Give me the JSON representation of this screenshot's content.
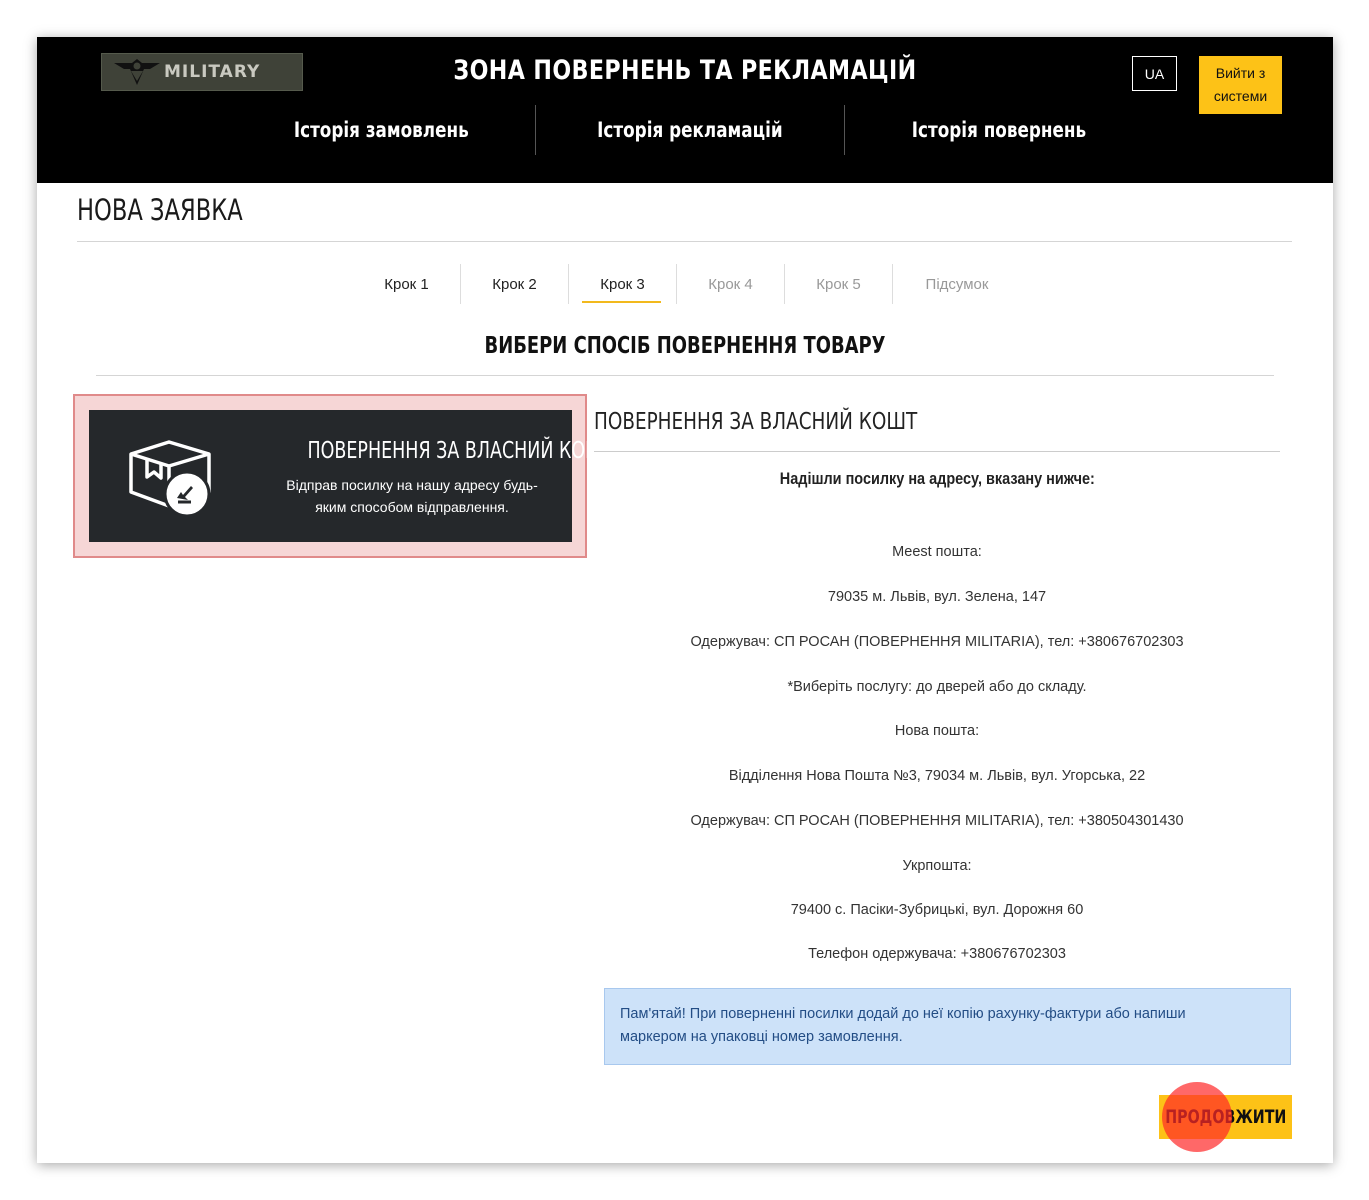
{
  "header": {
    "logo_text": "MILITARY",
    "title": "ЗОНА ПОВЕРНЕНЬ ТА РЕКЛАМАЦІЙ",
    "lang": "UA",
    "logout_line1": "Вийти з",
    "logout_line2": "системи",
    "nav": [
      {
        "label": "Історія замовлень"
      },
      {
        "label": "Історія рекламацій"
      },
      {
        "label": "Історія повернень"
      }
    ]
  },
  "page": {
    "title": "НОВА ЗАЯВКА",
    "steps": [
      {
        "label": "Крок 1",
        "state": "done"
      },
      {
        "label": "Крок 2",
        "state": "done"
      },
      {
        "label": "Крок 3",
        "state": "active"
      },
      {
        "label": "Крок 4",
        "state": "disabled"
      },
      {
        "label": "Крок 5",
        "state": "disabled"
      },
      {
        "label": "Підсумок",
        "state": "disabled"
      }
    ],
    "section_heading": "ВИБЕРИ СПОСІБ ПОВЕРНЕННЯ ТОВАРУ"
  },
  "option": {
    "icon": "box-return-icon",
    "title": "ПОВЕРНЕННЯ ЗА ВЛАСНИЙ КОШТ",
    "desc_line1": "Відправ посилку на нашу адресу будь-",
    "desc_line2": "яким способом відправлення."
  },
  "details": {
    "title": "ПОВЕРНЕННЯ ЗА ВЛАСНИЙ КОШТ",
    "subtitle": "Надішли посилку на адресу, вказану нижче:",
    "lines": [
      "Meest пошта:",
      "79035 м. Львів, вул. Зелена, 147",
      "Одержувач: СП РОСАН (ПОВЕРНЕННЯ MILITARIA), тел: +380676702303",
      "*Виберіть послугу: до дверей або до складу.",
      "Нова пошта:",
      "Відділення Нова Пошта №3, 79034 м. Львів, вул. Угорська, 22",
      "Одержувач: СП РОСАН (ПОВЕРНЕННЯ MILITARIA), тел: +380504301430",
      "Укрпошта:",
      "79400 с. Пасіки-Зубрицькі, вул. Дорожня 60",
      "Телефон одержувача: +380676702303"
    ],
    "notice_line1": "Пам'ятай! При поверненні посилки додай до неї копію рахунку-фактури або напиши",
    "notice_line2": "маркером на упаковці номер замовлення."
  },
  "actions": {
    "continue_label": "ПРОДОВЖИТИ"
  },
  "colors": {
    "accent": "#fdc217",
    "header_bg": "#000000",
    "card_bg": "#25282b",
    "notice_bg": "#cde2f9",
    "notice_text": "#234d85",
    "selection_outline": "#e08a8a"
  }
}
